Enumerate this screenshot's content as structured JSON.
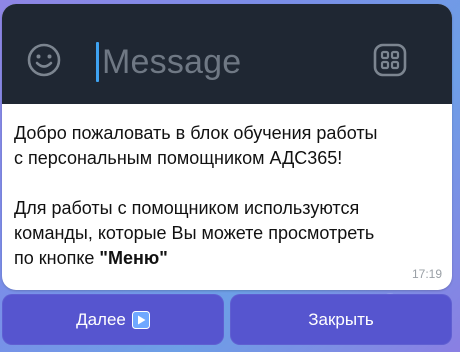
{
  "composer": {
    "placeholder": "Message",
    "emoji_icon": "smile-icon",
    "attach_icon": "grid-icon"
  },
  "message": {
    "line1": "Добро пожаловать в блок обучения работы",
    "line2": "с персональным помощником АДС365!",
    "line3": "Для работы с помощником используются",
    "line4": "команды, которые Вы можете просмотреть",
    "line5_prefix": "по кнопке ",
    "line5_bold": "\"Меню\"",
    "time": "17:19"
  },
  "buttons": {
    "next_label": "Далее",
    "next_icon": "play-icon",
    "close_label": "Закрыть"
  },
  "colors": {
    "composer_bg": "#1f2733",
    "button_bg": "#5655cf",
    "caret": "#3fa3f2"
  }
}
